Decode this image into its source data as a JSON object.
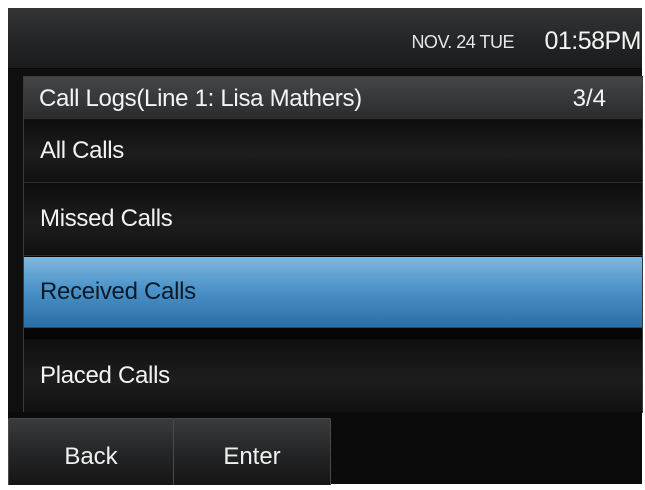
{
  "status_bar": {
    "date": "NOV. 24 TUE",
    "time": "01:58PM"
  },
  "call_logs": {
    "title": "Call Logs(Line 1: Lisa Mathers)",
    "page": "3/4",
    "items": [
      {
        "label": "All Calls",
        "selected": false
      },
      {
        "label": "Missed Calls",
        "selected": false
      },
      {
        "label": "Received Calls",
        "selected": true
      },
      {
        "label": "Placed Calls",
        "selected": false
      }
    ]
  },
  "softkeys": {
    "back": "Back",
    "enter": "Enter"
  },
  "colors": {
    "selection": "#4c93c9",
    "background": "#0f0f10",
    "text": "#f2f2f2"
  }
}
